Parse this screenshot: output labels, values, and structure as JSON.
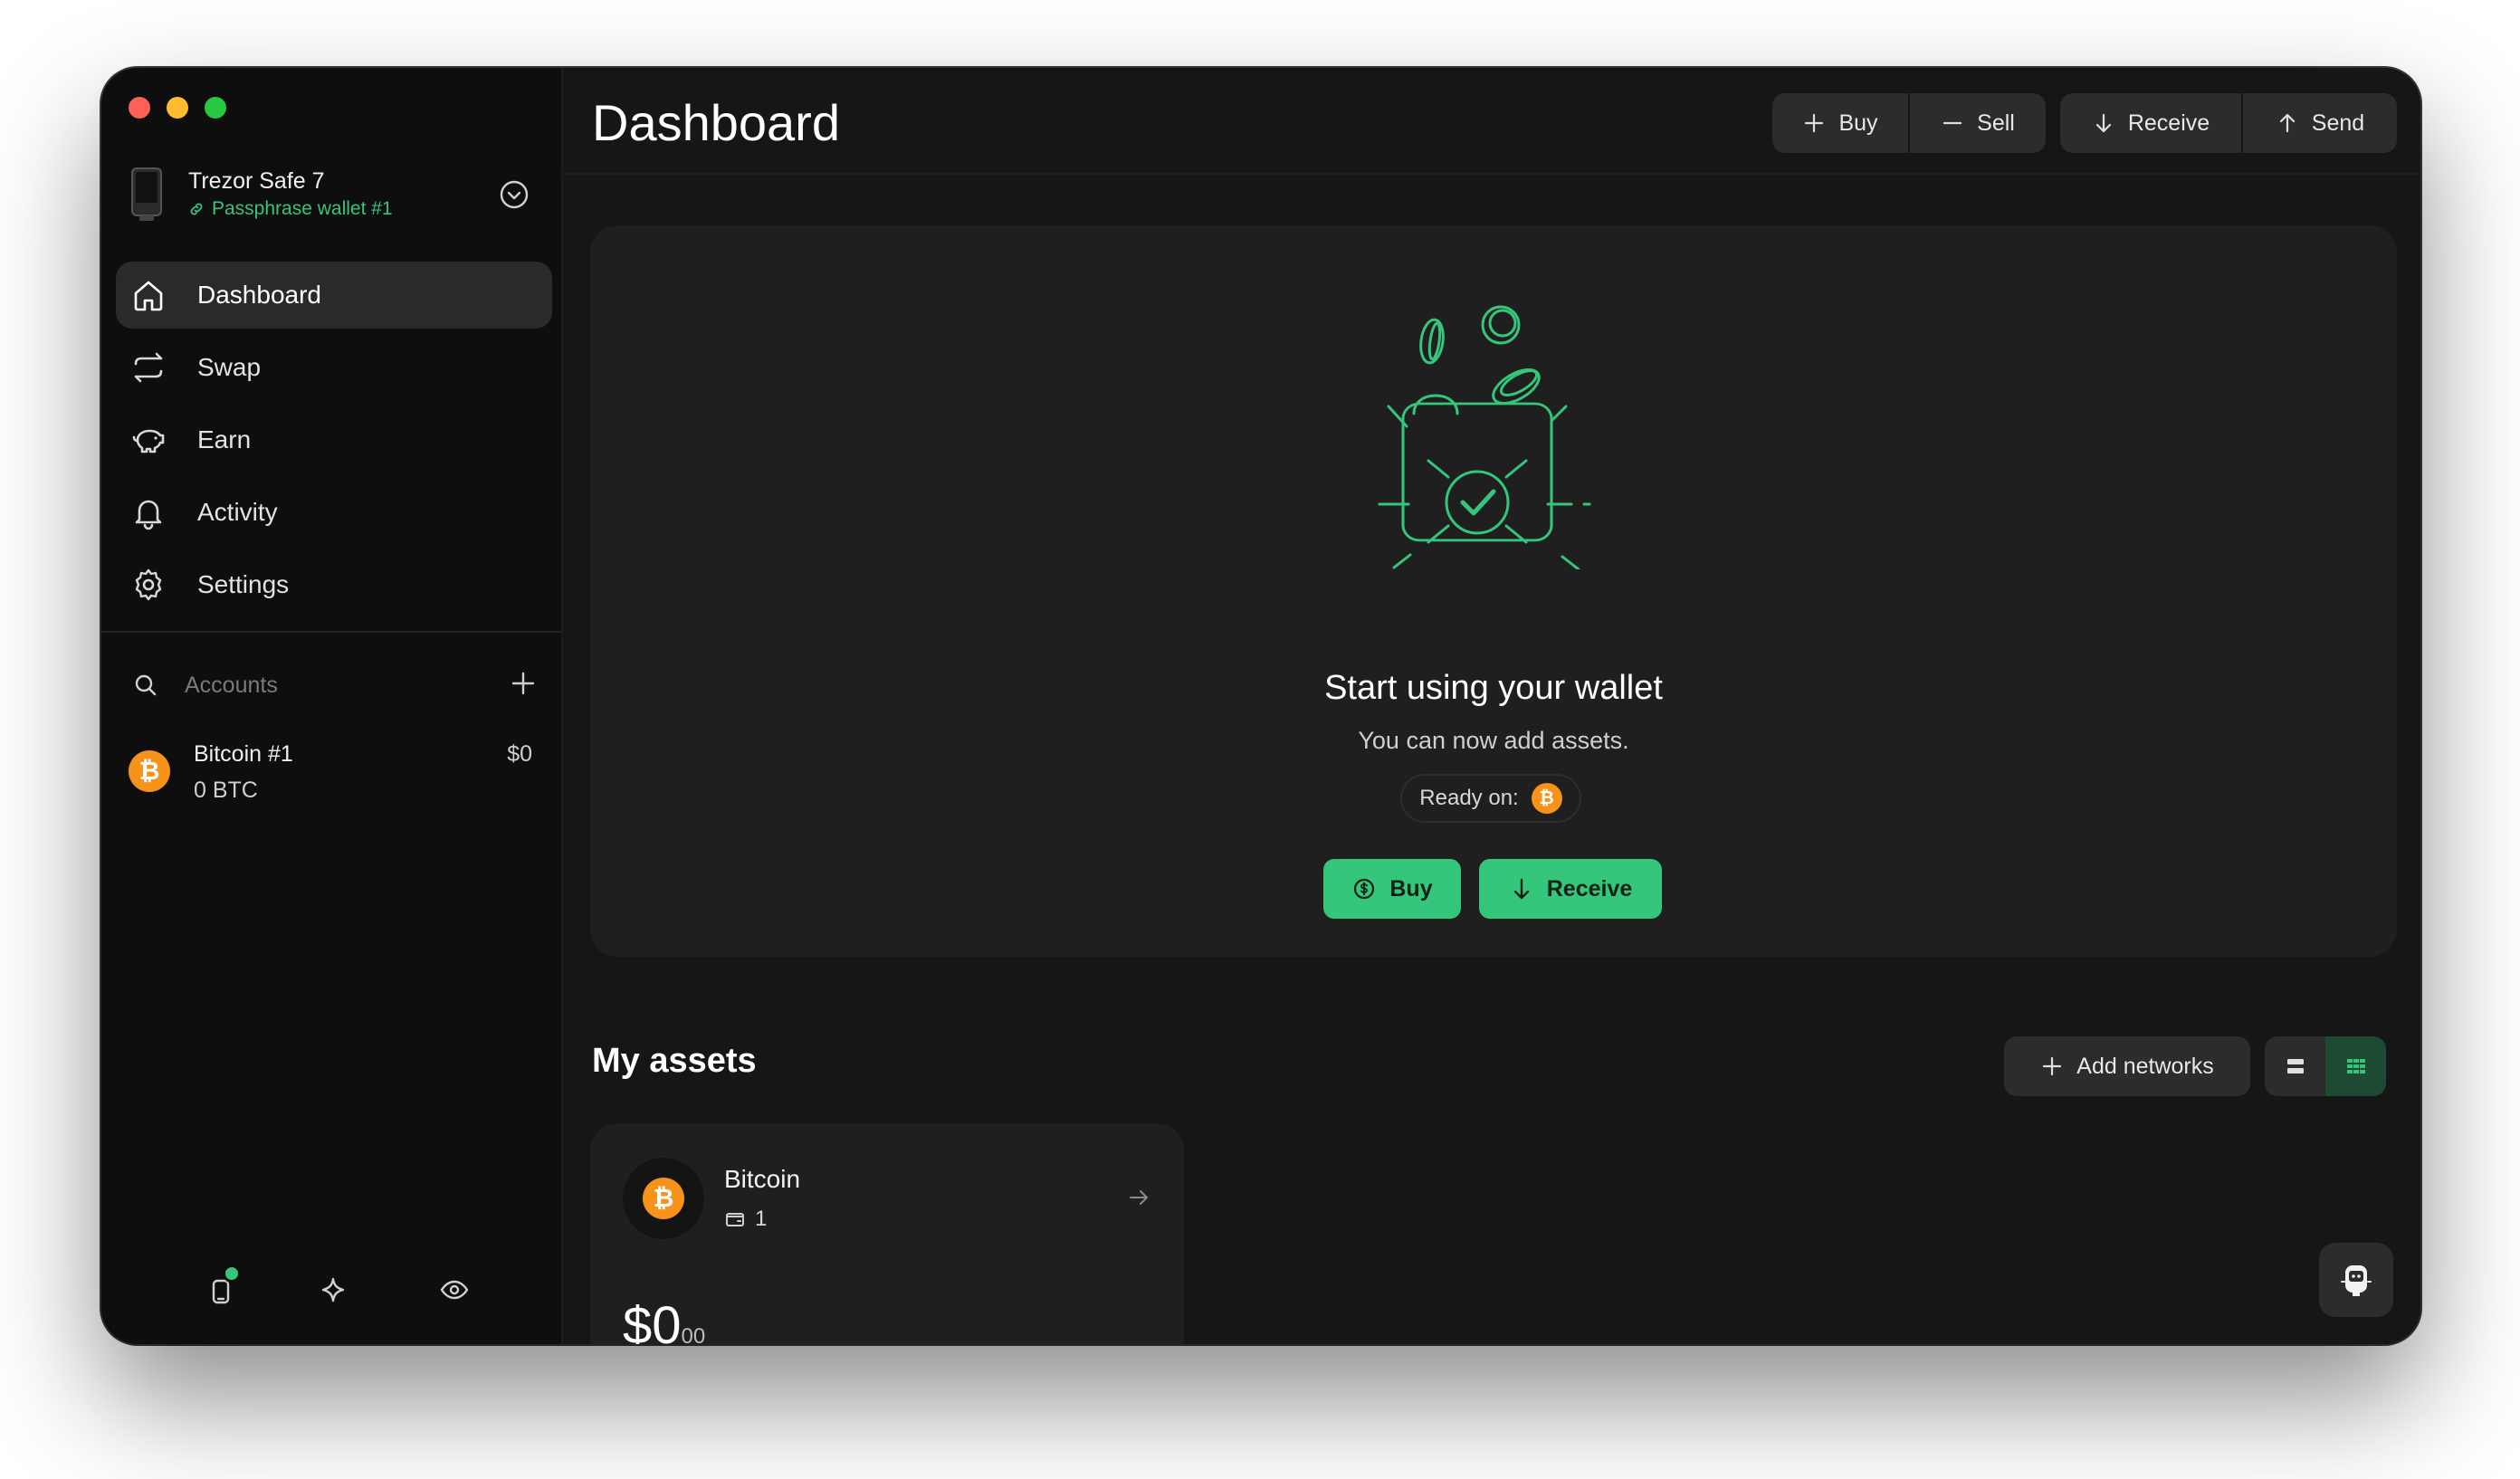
{
  "device": {
    "name": "Trezor Safe 7",
    "wallet": "Passphrase wallet #1"
  },
  "nav": [
    {
      "label": "Dashboard",
      "icon": "home-icon",
      "active": true
    },
    {
      "label": "Swap",
      "icon": "swap-icon",
      "active": false
    },
    {
      "label": "Earn",
      "icon": "piggy-bank-icon",
      "active": false
    },
    {
      "label": "Activity",
      "icon": "bell-icon",
      "active": false
    },
    {
      "label": "Settings",
      "icon": "gear-icon",
      "active": false
    }
  ],
  "accounts": {
    "search_label": "Accounts",
    "items": [
      {
        "name": "Bitcoin #1",
        "balance": "0 BTC",
        "fiat": "$0",
        "coin_symbol": "₿"
      }
    ]
  },
  "header": {
    "title": "Dashboard",
    "buy": "Buy",
    "sell": "Sell",
    "receive": "Receive",
    "send": "Send"
  },
  "hero": {
    "title": "Start using your wallet",
    "subtitle": "You can now add assets.",
    "ready_label": "Ready on:",
    "buy": "Buy",
    "receive": "Receive"
  },
  "assets": {
    "title": "My assets",
    "add_networks": "Add networks",
    "cards": [
      {
        "name": "Bitcoin",
        "accounts_count": "1",
        "value": "$0",
        "value_decimals": "00"
      }
    ]
  },
  "colors": {
    "accent": "#34c77b",
    "bitcoin": "#f7931a",
    "background": "#161616",
    "sidebar": "#0e0e0e",
    "card": "#1f1f1f"
  }
}
